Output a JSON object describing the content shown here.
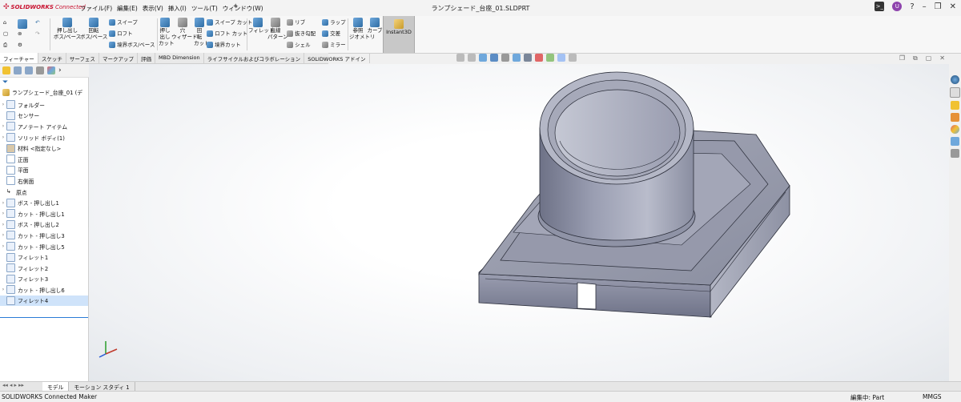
{
  "titlebar": {
    "app_name": "SOLIDWORKS",
    "app_suffix": "Connected",
    "menus": [
      "ファイル(F)",
      "編集(E)",
      "表示(V)",
      "挿入(I)",
      "ツール(T)",
      "ウィンドウ(W)"
    ],
    "document_title": "ランプシェード_台座_01.SLDPRT",
    "avatar_letter": "U"
  },
  "ribbon": {
    "extrude_boss": [
      "押し出し",
      "ボス/ベース"
    ],
    "revolve_boss": [
      "回転",
      "ボス/ベース"
    ],
    "sweep": "スイープ",
    "loft": "ロフト",
    "boundary_boss": "境界ボス/ベース",
    "extrude_cut": [
      "押し",
      "出し",
      "カット"
    ],
    "hole_wizard": [
      "穴",
      "ウィザード"
    ],
    "revolve_cut": [
      "回",
      "転",
      "カット"
    ],
    "swept_cut": "スイープ カット",
    "lofted_cut": "ロフト カット",
    "boundary_cut": "境界カット",
    "fillet": "フィレット",
    "linear_pattern": [
      "直線",
      "パターン"
    ],
    "rib": "リブ",
    "draft": "抜き勾配",
    "shell": "シェル",
    "wrap": "ラップ",
    "intersect": "交差",
    "mirror": "ミラー",
    "ref_geometry": [
      "参照",
      "ジオメトリ"
    ],
    "curves": "カーブ",
    "instant3d": "Instant3D"
  },
  "command_tabs": [
    "フィーチャー",
    "スケッチ",
    "サーフェス",
    "マークアップ",
    "評価",
    "MBD Dimension",
    "ライフサイクルおよびコラボレーション",
    "SOLIDWORKS アドイン"
  ],
  "feature_tree": {
    "root": "ランプシェード_台座_01 (デ",
    "items": [
      {
        "label": "フォルダー",
        "expandable": true
      },
      {
        "label": "センサー",
        "expandable": false
      },
      {
        "label": "アノテート アイテム",
        "expandable": true
      },
      {
        "label": "ソリッド ボディ(1)",
        "expandable": true
      },
      {
        "label": "材料 <指定なし>",
        "expandable": false
      },
      {
        "label": "正面",
        "expandable": false
      },
      {
        "label": "平面",
        "expandable": false
      },
      {
        "label": "右側面",
        "expandable": false
      },
      {
        "label": "原点",
        "expandable": false
      },
      {
        "label": "ボス - 押し出し1",
        "expandable": true
      },
      {
        "label": "カット - 押し出し1",
        "expandable": true
      },
      {
        "label": "ボス - 押し出し2",
        "expandable": true
      },
      {
        "label": "カット - 押し出し3",
        "expandable": true
      },
      {
        "label": "カット - 押し出し5",
        "expandable": true
      },
      {
        "label": "フィレット1",
        "expandable": false
      },
      {
        "label": "フィレット2",
        "expandable": false
      },
      {
        "label": "フィレット3",
        "expandable": false
      },
      {
        "label": "カット - 押し出し6",
        "expandable": true
      },
      {
        "label": "フィレット4",
        "expandable": false
      }
    ]
  },
  "bottom_tabs": [
    "モデル",
    "モーション スタディ 1"
  ],
  "status": {
    "left": "SOLIDWORKS Connected Maker",
    "editing": "編集中: Part",
    "units": "MMGS"
  },
  "colors": {
    "accent_blue": "#2a7bd6",
    "model_body": "#8f94a6",
    "selection": "#cfe3fa"
  }
}
